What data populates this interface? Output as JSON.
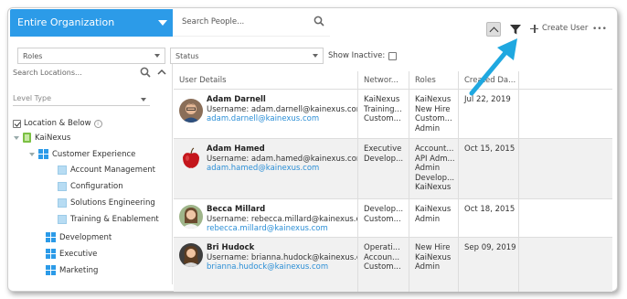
{
  "org": {
    "title": "Entire Organization"
  },
  "filters": {
    "roles": "Roles",
    "status": "Status",
    "show_inactive": "Show Inactive:"
  },
  "search": {
    "people_placeholder": "Search People..."
  },
  "toolbar": {
    "create_user": "Create User",
    "more": "•••"
  },
  "locations": {
    "search_placeholder": "Search Locations...",
    "level_type": "Level Type",
    "location_below": "Location & Below",
    "tree": [
      {
        "label": "KaiNexus",
        "icon": "kainexus-icon"
      },
      {
        "label": "Customer Experience",
        "icon": "grid-icon"
      },
      {
        "label": "Account Management",
        "icon": "square-icon"
      },
      {
        "label": "Configuration",
        "icon": "square-icon"
      },
      {
        "label": "Solutions Engineering",
        "icon": "square-icon"
      },
      {
        "label": "Training & Enablement",
        "icon": "square-icon"
      },
      {
        "label": "Development",
        "icon": "grid-icon"
      },
      {
        "label": "Executive",
        "icon": "grid-icon"
      },
      {
        "label": "Marketing",
        "icon": "grid-icon"
      }
    ]
  },
  "table": {
    "headers": [
      "User Details",
      "Networ...",
      "Roles",
      "Created Da..."
    ],
    "rows": [
      {
        "name": "Adam Darnell",
        "username": "Username: adam.darnell@kainexus.com",
        "email": "adam.darnell@kainexus.com",
        "networks": [
          "KaiNexus",
          "Training...",
          "Custom..."
        ],
        "roles": [
          "KaiNexus",
          "New Hire",
          "Custom...",
          "Admin"
        ],
        "created": "Jul 22, 2019"
      },
      {
        "name": "Adam Hamed",
        "username": "Username: adam.hamed@kainexus.com",
        "email": "adam.hamed@kainexus.com",
        "networks": [
          "Executive",
          "Develop..."
        ],
        "roles": [
          "Account...",
          "API Adm...",
          "Admin",
          "Develop...",
          "KaiNexus"
        ],
        "created": "Oct 15, 2015"
      },
      {
        "name": "Becca Millard",
        "username": "Username: rebecca.millard@kainexus.com",
        "email": "rebecca.millard@kainexus.com",
        "networks": [
          "Develop...",
          "Custom..."
        ],
        "roles": [
          "KaiNexus",
          "Admin"
        ],
        "created": "Oct 18, 2015"
      },
      {
        "name": "Bri Hudock",
        "username": "Username: brianna.hudock@kainexus.com",
        "email": "brianna.hudock@kainexus.com",
        "networks": [
          "Operati...",
          "Accoun...",
          "Custom..."
        ],
        "roles": [
          "New Hire",
          "KaiNexus",
          "Admin"
        ],
        "created": "Sep 09, 2019"
      }
    ]
  },
  "colors": {
    "accent": "#2c9be8",
    "link": "#2c8fd6",
    "arrow": "#1fa8e0"
  }
}
